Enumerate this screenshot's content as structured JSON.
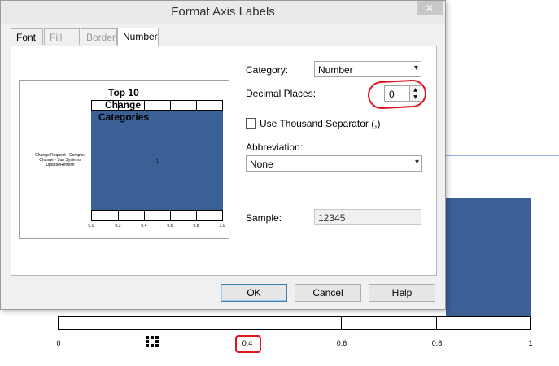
{
  "dialog": {
    "title": "Format Axis Labels",
    "close_glyph": "✕",
    "tabs": [
      {
        "label": "Font",
        "state": "enabled"
      },
      {
        "label": "Fill",
        "state": "disabled"
      },
      {
        "label": "Border",
        "state": "disabled"
      },
      {
        "label": "Number",
        "state": "active"
      }
    ],
    "category": {
      "label": "Category:",
      "value": "Number"
    },
    "decimal_places": {
      "label": "Decimal Places:",
      "value": "0"
    },
    "thousand_separator": {
      "label": "Use Thousand Separator (,)",
      "checked": false
    },
    "abbreviation": {
      "label": "Abbreviation:",
      "value": "None"
    },
    "sample": {
      "label": "Sample:",
      "value": "12345"
    },
    "buttons": {
      "ok": "OK",
      "cancel": "Cancel",
      "help": "Help"
    },
    "preview": {
      "title_lines": [
        "Top 10",
        "Change",
        "Categories"
      ],
      "category_label": "Change Request - Complex Change - Sun Systems Update/Refresh",
      "point_label": "1",
      "ticks": [
        "0.0",
        "0.2",
        "0.4",
        "0.6",
        "0.8",
        "1.0"
      ]
    }
  },
  "background_chart": {
    "ticks": [
      "0",
      "0.4",
      "0.6",
      "0.8",
      "1"
    ]
  },
  "colors": {
    "bar": "#3a6096",
    "annotation_red": "#e0141b",
    "accent_line": "#8db4e8"
  }
}
